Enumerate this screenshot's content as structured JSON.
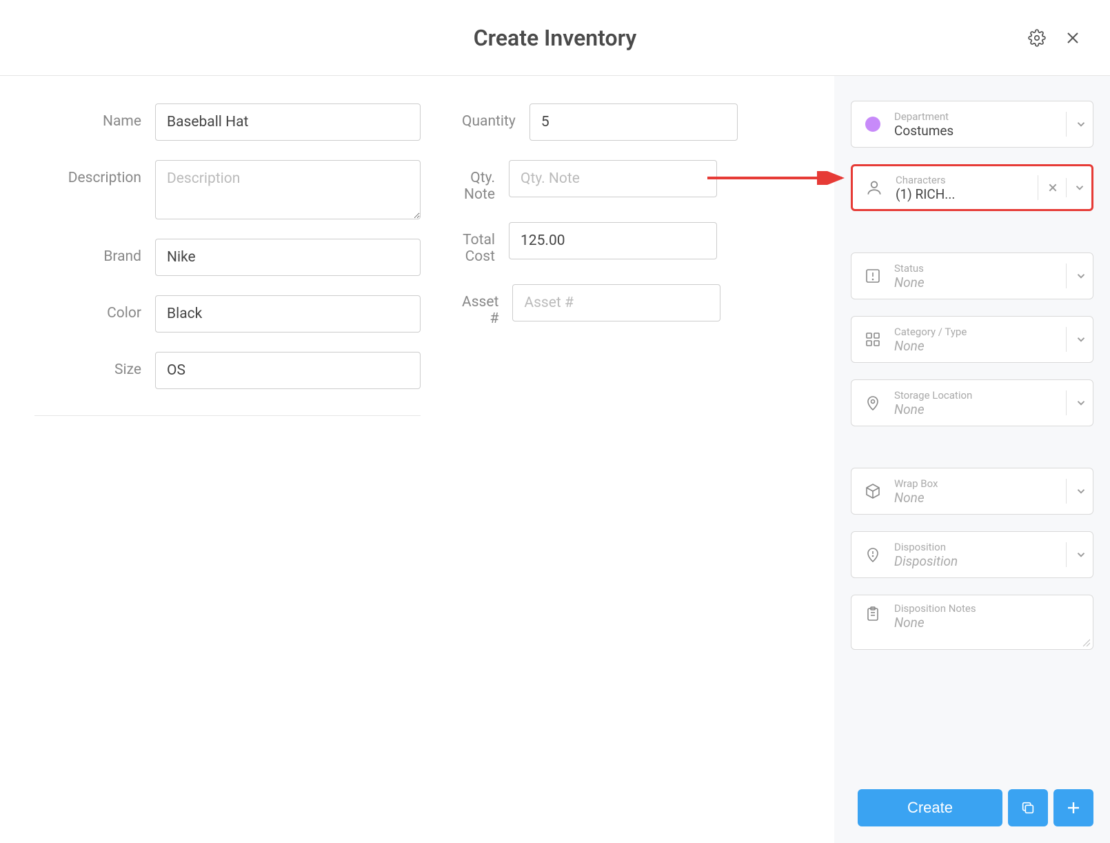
{
  "header": {
    "title": "Create Inventory"
  },
  "fields": {
    "name": {
      "label": "Name",
      "value": "Baseball Hat"
    },
    "description": {
      "label": "Description",
      "placeholder": "Description",
      "value": ""
    },
    "brand": {
      "label": "Brand",
      "value": "Nike"
    },
    "color": {
      "label": "Color",
      "value": "Black"
    },
    "size": {
      "label": "Size",
      "value": "OS"
    },
    "quantity": {
      "label": "Quantity",
      "value": "5"
    },
    "qtynote": {
      "label": "Qty. Note",
      "placeholder": "Qty. Note",
      "value": ""
    },
    "totalcost": {
      "label": "Total Cost",
      "value": "125.00"
    },
    "asset": {
      "label": "Asset #",
      "placeholder": "Asset #",
      "value": ""
    }
  },
  "sidebar": {
    "department": {
      "label": "Department",
      "value": "Costumes",
      "dotColor": "#c78af9"
    },
    "characters": {
      "label": "Characters",
      "value": "(1) RICH..."
    },
    "status": {
      "label": "Status",
      "value": "None"
    },
    "category": {
      "label": "Category / Type",
      "value": "None"
    },
    "storage": {
      "label": "Storage Location",
      "value": "None"
    },
    "wrapbox": {
      "label": "Wrap Box",
      "value": "None"
    },
    "disposition": {
      "label": "Disposition",
      "value": "Disposition"
    },
    "dispnotes": {
      "label": "Disposition Notes",
      "value": "None"
    }
  },
  "footer": {
    "create": "Create"
  }
}
